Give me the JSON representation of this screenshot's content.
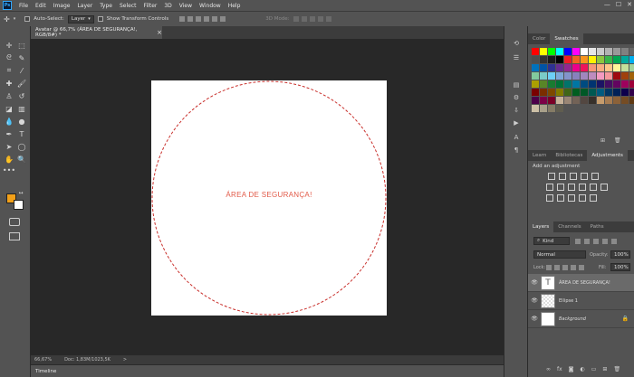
{
  "app": {
    "logo": "Ps"
  },
  "menu": [
    "File",
    "Edit",
    "Image",
    "Layer",
    "Type",
    "Select",
    "Filter",
    "3D",
    "View",
    "Window",
    "Help"
  ],
  "window_controls": {
    "minimize": "—",
    "maximize": "☐",
    "close": "✕"
  },
  "options": {
    "auto_select": "Auto-Select:",
    "layer_dropdown": "Layer",
    "show_transform": "Show Transform Controls",
    "mode_3d": "3D Mode:"
  },
  "document": {
    "tab_title": "Avatar @ 66,7% (ÁREA DE SEGURANÇA!, RGB/8#) *",
    "close": "×"
  },
  "canvas": {
    "safety_text": "ÁREA DE SEGURANÇA!",
    "safety_color": "#e25a48",
    "circle_color": "#c9302c"
  },
  "status": {
    "zoom": "66,67%",
    "doc": "Doc: 1,83M/1023,5K",
    "arrow": ">"
  },
  "timeline": {
    "label": "Timeline"
  },
  "panels": {
    "color_tabs": [
      "Color",
      "Swatches"
    ],
    "adjust_tabs": [
      "Learn",
      "Bibliotecas",
      "Adjustments"
    ],
    "adjust_heading": "Add an adjustment",
    "layers_tabs": [
      "Layers",
      "Channels",
      "Paths"
    ],
    "kind": "Kind",
    "blend": "Normal",
    "opacity_label": "Opacity:",
    "opacity": "100%",
    "lock_label": "Lock:",
    "fill_label": "Fill:",
    "fill": "100%",
    "layers": [
      {
        "name": "ÁREA DE SEGURANÇA!",
        "type": "text",
        "thumb": "T"
      },
      {
        "name": "Ellipse 1",
        "type": "shape",
        "thumb": ""
      },
      {
        "name": "Background",
        "type": "background",
        "thumb": ""
      }
    ]
  },
  "swatches": [
    "#ff0000",
    "#ffff00",
    "#00ff00",
    "#00ffff",
    "#0000ff",
    "#ff00ff",
    "#ffffff",
    "#e6e6e6",
    "#cccccc",
    "#b3b3b3",
    "#999999",
    "#808080",
    "#666666",
    "#4d4d4d",
    "#333333",
    "#1a1a1a",
    "#000000",
    "#ed1c24",
    "#f26522",
    "#f7941d",
    "#fff200",
    "#8dc63f",
    "#39b54a",
    "#00a651",
    "#00a99d",
    "#00aeef",
    "#0072bc",
    "#0054a6",
    "#2e3192",
    "#662d91",
    "#92278f",
    "#ec008c",
    "#ed145b",
    "#f69679",
    "#f9ad81",
    "#fdc689",
    "#fff79a",
    "#c4df9b",
    "#a3d39c",
    "#82ca9d",
    "#7accc8",
    "#6dcff6",
    "#7da7d9",
    "#8393ca",
    "#8781bd",
    "#a187be",
    "#bd8cbf",
    "#f49ac1",
    "#f5989d",
    "#9e0b0f",
    "#a0410d",
    "#a36209",
    "#aba000",
    "#598527",
    "#197b30",
    "#007236",
    "#00746b",
    "#0076a3",
    "#004b80",
    "#003471",
    "#1b1464",
    "#440e62",
    "#630460",
    "#9e005d",
    "#9e0039",
    "#790000",
    "#7b2e00",
    "#7d4900",
    "#827b00",
    "#406618",
    "#005e20",
    "#005826",
    "#005952",
    "#005b7f",
    "#003663",
    "#002157",
    "#0d004c",
    "#32004b",
    "#4b0049",
    "#7b0046",
    "#7a0026",
    "#c7b299",
    "#998675",
    "#736357",
    "#534741",
    "#37302a",
    "#c69c6d",
    "#a67c52",
    "#8c6239",
    "#754c24",
    "#603913",
    "#ccc0a6",
    "#a8a08a",
    "#857c66",
    "#605d4f"
  ]
}
